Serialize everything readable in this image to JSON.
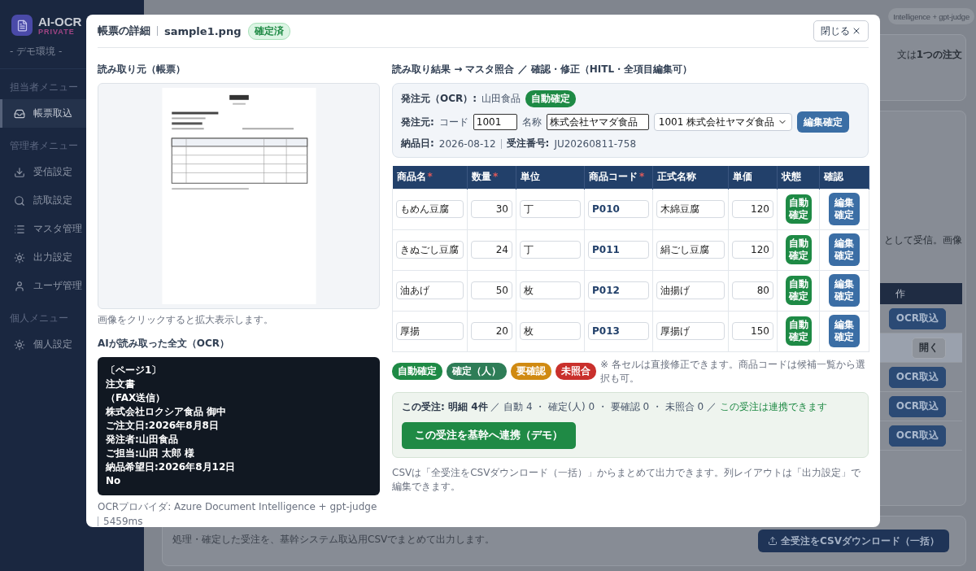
{
  "sidebar": {
    "logo": "AI-OCR",
    "logo_sub": "PRIVATE",
    "env": "- デモ環境 -",
    "sections": [
      {
        "title": "担当者メニュー",
        "items": [
          {
            "label": "帳票取込",
            "selected": true
          }
        ]
      },
      {
        "title": "管理者メニュー",
        "items": [
          {
            "label": "受信設定",
            "selected": false
          },
          {
            "label": "読取設定",
            "selected": false
          },
          {
            "label": "マスタ管理",
            "selected": false
          },
          {
            "label": "出力設定",
            "selected": false
          },
          {
            "label": "ユーザ管理",
            "selected": false
          }
        ]
      },
      {
        "title": "個人メニュー",
        "items": [
          {
            "label": "個人設定",
            "selected": false
          }
        ]
      }
    ]
  },
  "background": {
    "provider_pill": "Intelligence + gpt-judge",
    "card1_text": "文は**1つの注文**",
    "card2_text": "として受信。画像",
    "table_header": "作",
    "rows": [
      {
        "button": "OCR取込",
        "selected": false
      },
      {
        "button": "開く",
        "selected": true
      },
      {
        "button": "OCR取込",
        "selected": false
      },
      {
        "button": "OCR取込",
        "selected": false
      },
      {
        "button": "OCR取込",
        "selected": false
      }
    ],
    "export_note": "処理・確定した受注を、基幹システム取込用CSVでまとめて出力します。",
    "export_button": "全受注をCSVダウンロード（一括）"
  },
  "modal": {
    "title": "帳票の詳細",
    "file": "sample1.png",
    "status": "確定済",
    "close": "閉じる",
    "source": {
      "heading": "読み取り元（帳票）",
      "caption": "画像をクリックすると拡大表示します。"
    },
    "ocr": {
      "heading": "AIが読み取った全文（OCR）",
      "lines": [
        "〔ページ1〕",
        "注文書",
        "（FAX送信）",
        "株式会社ロクシア食品 御中",
        "ご注文日:2026年8月8日",
        "発注者:山田食品",
        "ご担当:山田 太郎 様",
        "納品希望日:2026年8月12日",
        "No"
      ],
      "provider": "OCRプロバイダ: Azure Document Intelligence + gpt-judge",
      "time": "5459ms"
    },
    "result": {
      "heading": "読み取り結果 → マスタ照合 ／ 確認・修正（HITL・全項目編集可）",
      "supplier": {
        "ocr_label": "発注元（OCR）:",
        "ocr_value": "山田食品",
        "badge": "自動確定",
        "row_label": "発注元:",
        "code_label": "コード",
        "code": "1001",
        "name_label": "名称",
        "name": "株式会社ヤマダ食品",
        "select": "1001 株式会社ヤマダ食品",
        "confirm": "編集確定",
        "date_label": "納品日:",
        "date": "2026-08-12",
        "order_label": "受注番号:",
        "order": "JU20260811-758"
      },
      "columns": [
        {
          "label": "商品名",
          "mark": "*"
        },
        {
          "label": "数量",
          "mark": "*"
        },
        {
          "label": "単位"
        },
        {
          "label": "商品コード",
          "mark": "*"
        },
        {
          "label": "正式名称"
        },
        {
          "label": "単価"
        },
        {
          "label": "状態"
        },
        {
          "label": "確認"
        }
      ],
      "rows": [
        {
          "name": "もめん豆腐",
          "qty": "30",
          "unit": "丁",
          "code": "P010",
          "official": "木綿豆腐",
          "price": "120",
          "status": "自動確定",
          "color": "#1e8a45",
          "action": "編集確定"
        },
        {
          "name": "きぬごし豆腐",
          "qty": "24",
          "unit": "丁",
          "code": "P011",
          "official": "絹ごし豆腐",
          "price": "120",
          "status": "自動確定",
          "color": "#1e8a45",
          "action": "編集確定"
        },
        {
          "name": "油あげ",
          "qty": "50",
          "unit": "枚",
          "code": "P012",
          "official": "油揚げ",
          "price": "80",
          "status": "自動確定",
          "color": "#1e8a45",
          "action": "編集確定"
        },
        {
          "name": "厚揚",
          "qty": "20",
          "unit": "枚",
          "code": "P013",
          "official": "厚揚げ",
          "price": "150",
          "status": "自動確定",
          "color": "#1e8a45",
          "action": "編集確定"
        }
      ],
      "legend": [
        {
          "label": "自動確定",
          "color": "#1e8a45"
        },
        {
          "label": "確定（人）",
          "color": "#2e7d57"
        },
        {
          "label": "要確認",
          "color": "#d08a12"
        },
        {
          "label": "未照合",
          "color": "#c9302c"
        }
      ],
      "legend_note": "※ 各セルは直接修正できます。商品コードは候補一覧から選択も可。",
      "summary": {
        "lead": "この受注: 明細 4件",
        "counts": "／ 自動 4 ・ 確定(人) 0 ・ 要確認 0 ・ 未照合 0 ／",
        "ok": "この受注は連携できます",
        "button": "この受注を基幹へ連携（デモ）"
      },
      "footer_note": "CSVは「全受注をCSVダウンロード（一括）」からまとめて出力できます。列レイアウトは「出力設定」で編集できます。"
    }
  }
}
